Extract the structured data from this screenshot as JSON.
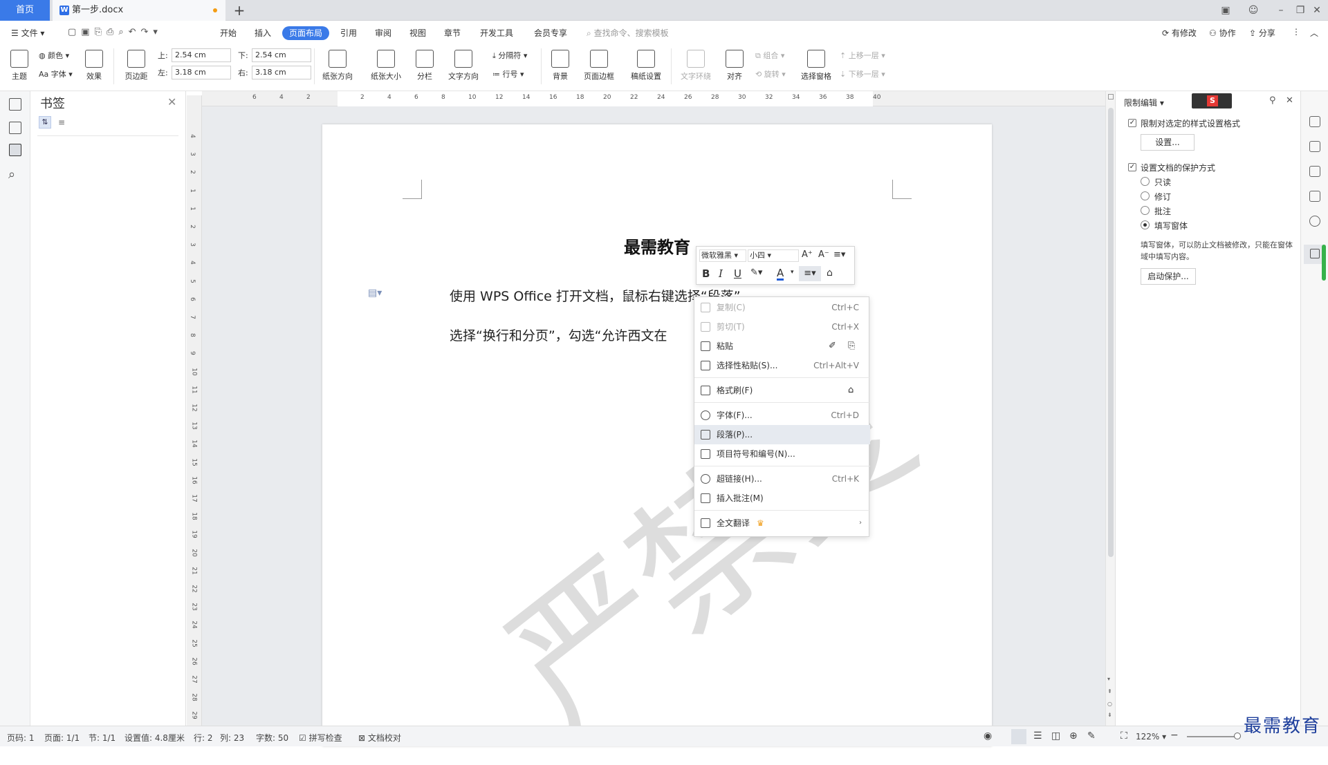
{
  "tabs": {
    "home": "首页",
    "doc": "第一步.docx",
    "add": "+"
  },
  "window": {
    "minimize": "–",
    "restore": "❐",
    "close": "✕"
  },
  "menubar": {
    "file": "文件",
    "items": [
      "开始",
      "插入",
      "页面布局",
      "引用",
      "审阅",
      "视图",
      "章节",
      "开发工具",
      "会员专享"
    ],
    "active": "页面布局",
    "search_placeholder": "查找命令、搜索模板",
    "right": [
      "有修改",
      "协作",
      "分享"
    ]
  },
  "ribbon": {
    "theme": "主题",
    "color": "颜色",
    "font": "Aa 字体",
    "effect": "效果",
    "margins": "页边距",
    "margin_top_label": "上:",
    "margin_top": "2.54 cm",
    "margin_bottom_label": "下:",
    "margin_bottom": "2.54 cm",
    "margin_left_label": "左:",
    "margin_left": "3.18 cm",
    "margin_right_label": "右:",
    "margin_right": "3.18 cm",
    "orientation": "纸张方向",
    "size": "纸张大小",
    "columns": "分栏",
    "text_direction": "文字方向",
    "breaks": "分隔符",
    "line_numbers": "行号",
    "background": "背景",
    "page_border": "页面边框",
    "manuscript": "稿纸设置",
    "wrap": "文字环绕",
    "align": "对齐",
    "group": "组合",
    "rotate": "旋转",
    "select_pane": "选择窗格",
    "bring_forward": "上移一层",
    "send_backward": "下移一层"
  },
  "bookmark_panel": {
    "title": "书签"
  },
  "ruler": {
    "h_ticks": [
      "6",
      "4",
      "2",
      "2",
      "4",
      "6",
      "8",
      "10",
      "12",
      "14",
      "16",
      "18",
      "20",
      "22",
      "24",
      "26",
      "28",
      "30",
      "32",
      "34",
      "36",
      "38",
      "40"
    ],
    "v_ticks": [
      "4",
      "3",
      "2",
      "1",
      "1",
      "2",
      "3",
      "4",
      "5",
      "6",
      "7",
      "8",
      "9",
      "10",
      "11",
      "12",
      "13",
      "14",
      "15",
      "16",
      "17",
      "18",
      "19",
      "20",
      "21",
      "22",
      "23",
      "24",
      "25",
      "26",
      "27",
      "28",
      "29"
    ]
  },
  "document": {
    "title": "最需教育",
    "p1": "使用 WPS Office 打开文档，鼠标右键选择“段落”。",
    "p2": "选择“换行和分页”，勾选“允许西文在",
    "watermark": "严禁复"
  },
  "format_bar": {
    "font": "微软雅黑",
    "size": "小四",
    "bold": "B",
    "italic": "I",
    "underline": "U",
    "font_color": "A"
  },
  "context_menu": {
    "copy": "复制(C)",
    "copy_sc": "Ctrl+C",
    "cut": "剪切(T)",
    "cut_sc": "Ctrl+X",
    "paste": "粘贴",
    "paste_special": "选择性粘贴(S)...",
    "paste_special_sc": "Ctrl+Alt+V",
    "format_painter": "格式刷(F)",
    "font": "字体(F)...",
    "font_sc": "Ctrl+D",
    "paragraph": "段落(P)...",
    "bullets": "项目符号和编号(N)...",
    "hyperlink": "超链接(H)...",
    "hyperlink_sc": "Ctrl+K",
    "insert_comment": "插入批注(M)",
    "translate": "全文翻译"
  },
  "restrict_panel": {
    "title": "限制编辑",
    "limit_format": "限制对选定的样式设置格式",
    "settings_btn": "设置...",
    "protect_mode": "设置文档的保护方式",
    "options": [
      "只读",
      "修订",
      "批注",
      "填写窗体"
    ],
    "selected_option": "填写窗体",
    "description": "填写窗体，可以防止文档被修改，只能在窗体域中填写内容。",
    "start_btn": "启动保护..."
  },
  "statusbar": {
    "page_no": "页码: 1",
    "pages": "页面: 1/1",
    "section": "节: 1/1",
    "setting": "设置值: 4.8厘米",
    "row": "行: 2",
    "col": "列: 23",
    "words": "字数: 50",
    "spell": "拼写检查",
    "proof": "文档校对",
    "zoom": "122%"
  },
  "logo": "最需教育",
  "colors": {
    "accent": "#3a7ae8",
    "tab_bg": "#dfe1e5",
    "doc_bg": "#e9ebee"
  }
}
